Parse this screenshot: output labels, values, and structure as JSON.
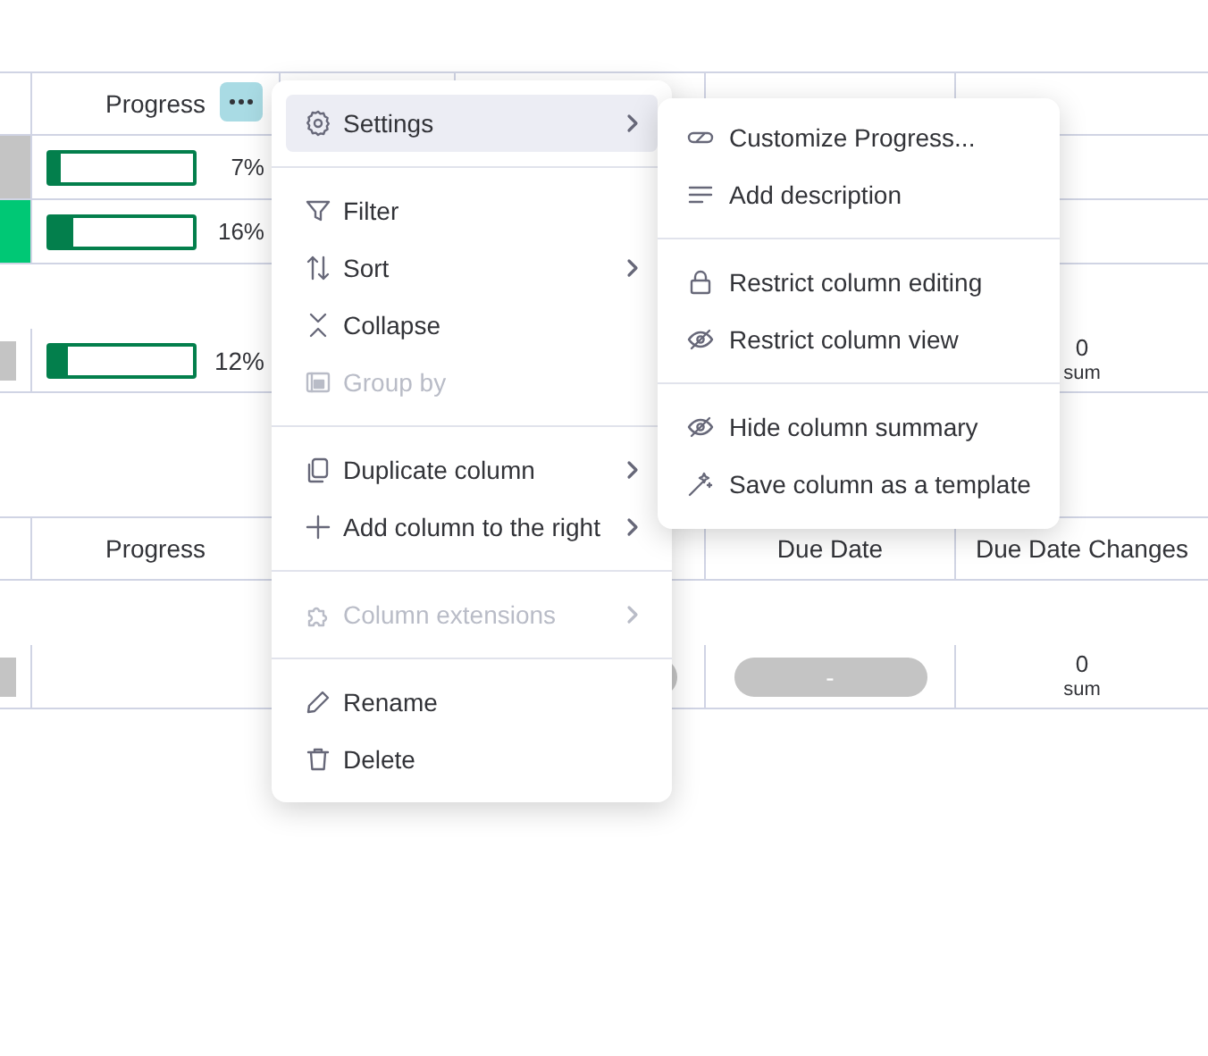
{
  "table_top": {
    "header": {
      "progress_label": "Progress",
      "menu_open": true
    },
    "rows": [
      {
        "color": "#c4c4c4",
        "level": 0.07,
        "percent": "7%"
      },
      {
        "color": "#00c875",
        "level": 0.16,
        "percent": "16%"
      }
    ],
    "summary": {
      "level": 0.12,
      "percent": "12%",
      "changes_value": "0",
      "changes_caption": "sum"
    }
  },
  "table_bottom": {
    "columns": [
      {
        "label": "Progress"
      },
      {
        "label": "Due Date"
      },
      {
        "label": "Due Date Changes"
      }
    ],
    "summary": {
      "due_date": "-",
      "changes_value": "0",
      "changes_caption": "sum"
    }
  },
  "column_menu": {
    "groups": [
      [
        {
          "label": "Settings",
          "selected": true,
          "disabled": false,
          "has_submenu": true
        }
      ],
      [
        {
          "label": "Filter",
          "selected": false,
          "disabled": false,
          "has_submenu": false
        },
        {
          "label": "Sort",
          "selected": false,
          "disabled": false,
          "has_submenu": true
        },
        {
          "label": "Collapse",
          "selected": false,
          "disabled": false,
          "has_submenu": false
        },
        {
          "label": "Group by",
          "selected": false,
          "disabled": true,
          "has_submenu": false
        }
      ],
      [
        {
          "label": "Duplicate column",
          "selected": false,
          "disabled": false,
          "has_submenu": true
        },
        {
          "label": "Add column to the right",
          "selected": false,
          "disabled": false,
          "has_submenu": true
        }
      ],
      [
        {
          "label": "Column extensions",
          "selected": false,
          "disabled": true,
          "has_submenu": true
        }
      ],
      [
        {
          "label": "Rename",
          "selected": false,
          "disabled": false,
          "has_submenu": false
        },
        {
          "label": "Delete",
          "selected": false,
          "disabled": false,
          "has_submenu": false
        }
      ]
    ]
  },
  "settings_submenu": {
    "groups": [
      [
        {
          "label": "Customize Progress..."
        },
        {
          "label": "Add description"
        }
      ],
      [
        {
          "label": "Restrict column editing"
        },
        {
          "label": "Restrict column view"
        }
      ],
      [
        {
          "label": "Hide column summary"
        },
        {
          "label": "Save column as a template"
        }
      ]
    ]
  }
}
